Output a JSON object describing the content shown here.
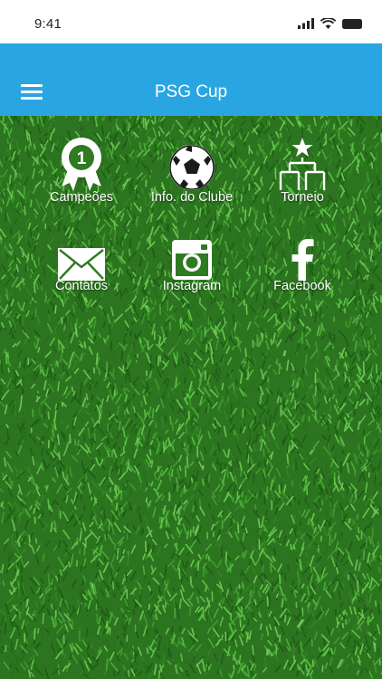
{
  "status_bar": {
    "time": "9:41",
    "icons": [
      "signal-icon",
      "wifi-icon",
      "battery-icon"
    ]
  },
  "app_bar": {
    "title": "PSG Cup",
    "menu_icon": "hamburger-menu-icon",
    "color": "#29a6e1"
  },
  "background": {
    "texture": "grass",
    "color": "#2f7a22"
  },
  "menu_grid": [
    {
      "label": "Campeões",
      "icon": "award-ribbon-icon",
      "badge": "1"
    },
    {
      "label": "Info. do Clube",
      "icon": "soccer-ball-icon"
    },
    {
      "label": "Torneio",
      "icon": "tournament-bracket-icon"
    },
    {
      "label": "Contatos",
      "icon": "envelope-icon"
    },
    {
      "label": "Instagram",
      "icon": "instagram-icon"
    },
    {
      "label": "Facebook",
      "icon": "facebook-icon"
    }
  ]
}
